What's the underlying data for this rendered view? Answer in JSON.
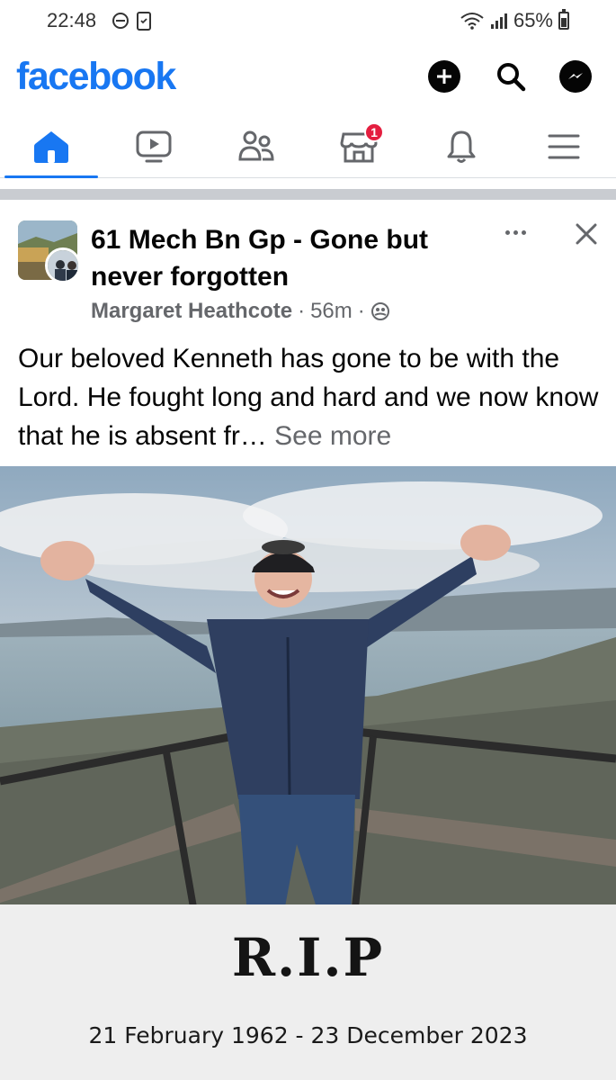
{
  "status_bar": {
    "time": "22:48",
    "battery": "65%"
  },
  "header": {
    "logo": "facebook",
    "brand_color": "#1877f2",
    "actions": [
      {
        "icon": "plus-icon"
      },
      {
        "icon": "search-icon"
      },
      {
        "icon": "messenger-icon"
      }
    ]
  },
  "tabs": [
    {
      "icon": "home-icon",
      "active": true
    },
    {
      "icon": "video-icon"
    },
    {
      "icon": "friends-icon"
    },
    {
      "icon": "marketplace-icon",
      "badge": "1"
    },
    {
      "icon": "bell-icon"
    },
    {
      "icon": "menu-icon"
    }
  ],
  "post": {
    "group_name": "61 Mech Bn Gp - Gone but never forgotten",
    "author": "Margaret Heathcote",
    "time": "56m",
    "separator": "·",
    "text": "Our beloved Kenneth has gone to be with the Lord. He fought long and hard and we now know that he is absent fr…",
    "see_more": "See more",
    "image": {
      "title": "R.I.P",
      "dates": "21 February 1962 - 23 December 2023"
    }
  }
}
